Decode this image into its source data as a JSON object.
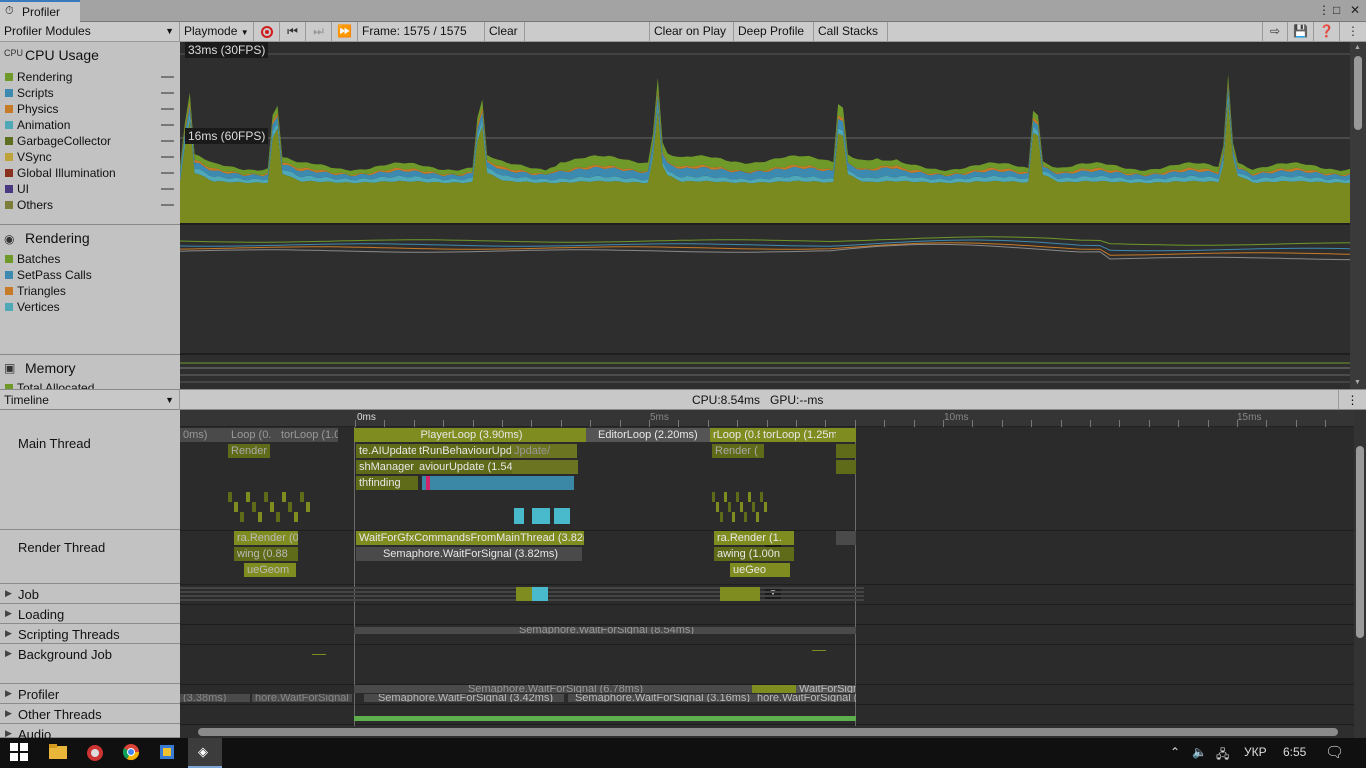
{
  "window": {
    "tab_title": "Profiler"
  },
  "toolbar": {
    "modules_label": "Profiler Modules",
    "target_label": "Playmode",
    "frame_label": "Frame: 1575 / 1575",
    "clear": "Clear",
    "clear_on_play": "Clear on Play",
    "deep_profile": "Deep Profile",
    "call_stacks": "Call Stacks"
  },
  "modules": {
    "cpu": {
      "title": "CPU Usage",
      "items": [
        {
          "label": "Rendering",
          "color": "#6f9a2a"
        },
        {
          "label": "Scripts",
          "color": "#3d8ab0"
        },
        {
          "label": "Physics",
          "color": "#c77a27"
        },
        {
          "label": "Animation",
          "color": "#4fa8b8"
        },
        {
          "label": "GarbageCollector",
          "color": "#5e6f22"
        },
        {
          "label": "VSync",
          "color": "#c0a23a"
        },
        {
          "label": "Global Illumination",
          "color": "#8b2f1f"
        },
        {
          "label": "UI",
          "color": "#4a3880"
        },
        {
          "label": "Others",
          "color": "#7d7d3a"
        }
      ]
    },
    "rendering": {
      "title": "Rendering",
      "items": [
        {
          "label": "Batches",
          "color": "#6f9a2a"
        },
        {
          "label": "SetPass Calls",
          "color": "#3d8ab0"
        },
        {
          "label": "Triangles",
          "color": "#c77a27"
        },
        {
          "label": "Vertices",
          "color": "#4fa8b8"
        }
      ]
    },
    "memory": {
      "title": "Memory",
      "items": [
        {
          "label": "Total Allocated",
          "color": "#6f9a2a"
        }
      ]
    }
  },
  "chart_labels": {
    "ms33": "33ms (30FPS)",
    "ms16": "16ms (60FPS)"
  },
  "timeline": {
    "view": "Timeline",
    "cpu": "CPU:8.54ms",
    "gpu": "GPU:--ms",
    "ruler": [
      "0ms",
      "5ms",
      "10ms",
      "15ms"
    ],
    "threads": [
      {
        "label": "Main Thread",
        "expand": false
      },
      {
        "label": "Render Thread",
        "expand": false
      },
      {
        "label": "Job",
        "expand": true
      },
      {
        "label": "Loading",
        "expand": true
      },
      {
        "label": "Scripting Threads",
        "expand": true
      },
      {
        "label": "Background Job",
        "expand": true
      },
      {
        "label": "Profiler",
        "expand": true
      },
      {
        "label": "Other Threads",
        "expand": true
      },
      {
        "label": "Audio",
        "expand": true
      }
    ],
    "blocks": {
      "prev_a": "0ms)",
      "prev_b": "Loop (0.",
      "prev_c": "torLoop (1.08(",
      "playerloop": "PlayerLoop (3.90ms)",
      "editorloop": "EditorLoop (2.20ms)",
      "next_a": "rLoop (0.8",
      "next_b": "torLoop (1.25m",
      "ai_update": "te.AIUpdate",
      "run_behaviour": "tRunBehaviourUpd",
      "update_faded": "Jpdate/",
      "manager": "shManager",
      "behaviour_update": "aviourUpdate (1.54",
      "pathfinding": "thfinding",
      "render_prev": "Render (",
      "render_next": "Render (",
      "wait_gfx": "WaitForGfxCommandsFromMainThread (3.82(",
      "semaphore_main": "Semaphore.WaitForSignal (3.82ms)",
      "ra_render_prev": "ra.Render (0",
      "ra_render_next": "ra.Render (1.",
      "drawing_prev": "wing (0.88",
      "drawing_next": "awing (1.00n",
      "queue_prev": "ueGeom",
      "queue_next": "ueGeo",
      "sem_scripting": "Semaphore.WaitForSignal (8.54ms)",
      "sem_profiler": "Semaphore.WaitForSignal (6.78ms)",
      "wait_next": "WaitForSign",
      "sem_other_prev": "(3.38ms)",
      "sem_other_prev2": "hore.WaitForSignal",
      "sem_other_1": "Semaphore.WaitForSignal (3.42ms)",
      "sem_other_2": "Semaphore.WaitForSignal (3.16ms)",
      "sem_other_3": "hore.WaitForSignal (1"
    }
  },
  "taskbar": {
    "lang": "УКР",
    "time": "6:55"
  }
}
